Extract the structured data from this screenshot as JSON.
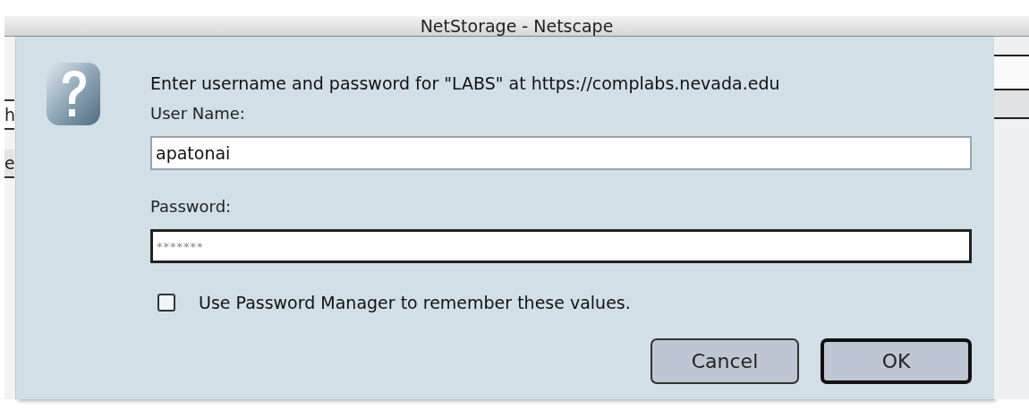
{
  "window": {
    "title": "NetStorage - Netscape"
  },
  "background_window": {
    "fragments": [
      "h",
      "e"
    ]
  },
  "dialog": {
    "message": "Enter username and password for \"LABS\" at https://complabs.nevada.edu",
    "fields": [
      {
        "label": "User Name:",
        "value": "apatonai",
        "focused": false,
        "kind": "text"
      },
      {
        "label": "Password:",
        "value": "*******",
        "focused": true,
        "kind": "masked"
      }
    ],
    "checkbox": {
      "label": "Use Password Manager to remember these values.",
      "checked": false
    },
    "buttons": [
      {
        "label": "Cancel",
        "default": false
      },
      {
        "label": "OK",
        "default": true
      }
    ]
  }
}
